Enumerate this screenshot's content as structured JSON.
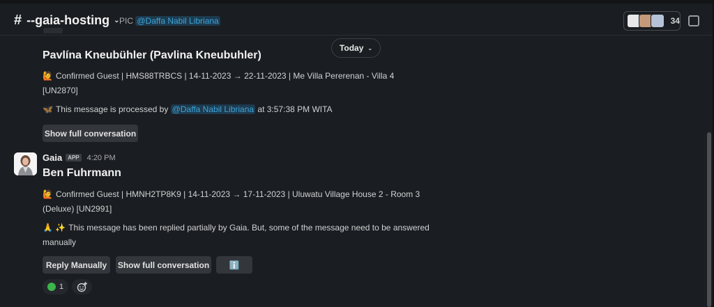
{
  "header": {
    "channel_name": "--gaia-hosting",
    "pic_label": "PIC",
    "pic_mention": "@Daffa Nabil Libriana",
    "member_count": "34"
  },
  "date_divider": {
    "label": "Today"
  },
  "message1": {
    "title": "Pavlína Kneubühler (Pavlina Kneubuhler)",
    "line1_emoji": "🙋",
    "line1": "Confirmed Guest | HMS88TRBCS | 14-11-2023 → 22-11-2023 | Me Villa Pererenan - Villa 4",
    "line2": "[UN2870]",
    "status_emoji": "🦋",
    "status_prefix": "This message is processed by",
    "status_mention": "@Daffa Nabil Libriana",
    "status_suffix": "at 3:57:38 PM WITA",
    "button_label": "Show full conversation"
  },
  "message2": {
    "sender": "Gaia",
    "badge": "APP",
    "time": "4:20 PM",
    "title": "Ben Fuhrmann",
    "line1_emoji": "🙋",
    "line1": "Confirmed Guest | HMNH2TP8K9 | 14-11-2023 → 17-11-2023 | Uluwatu Village House 2 - Room 3",
    "line2": "(Deluxe) [UN2991]",
    "note_emoji": "🙏 ✨",
    "note_line1": "This message has been replied partially by Gaia. But, some of the message need to be answered",
    "note_line2": "manually",
    "buttons": {
      "reply": "Reply Manually",
      "show": "Show full conversation",
      "info": "ℹ️"
    },
    "reaction_count": "1",
    "add_reaction_icon": "add-emoji-icon"
  },
  "colors": {
    "background": "#1a1d21",
    "mention_bg": "#1d3a4e",
    "mention_fg": "#3ea5d9",
    "button_bg": "#33363b"
  }
}
